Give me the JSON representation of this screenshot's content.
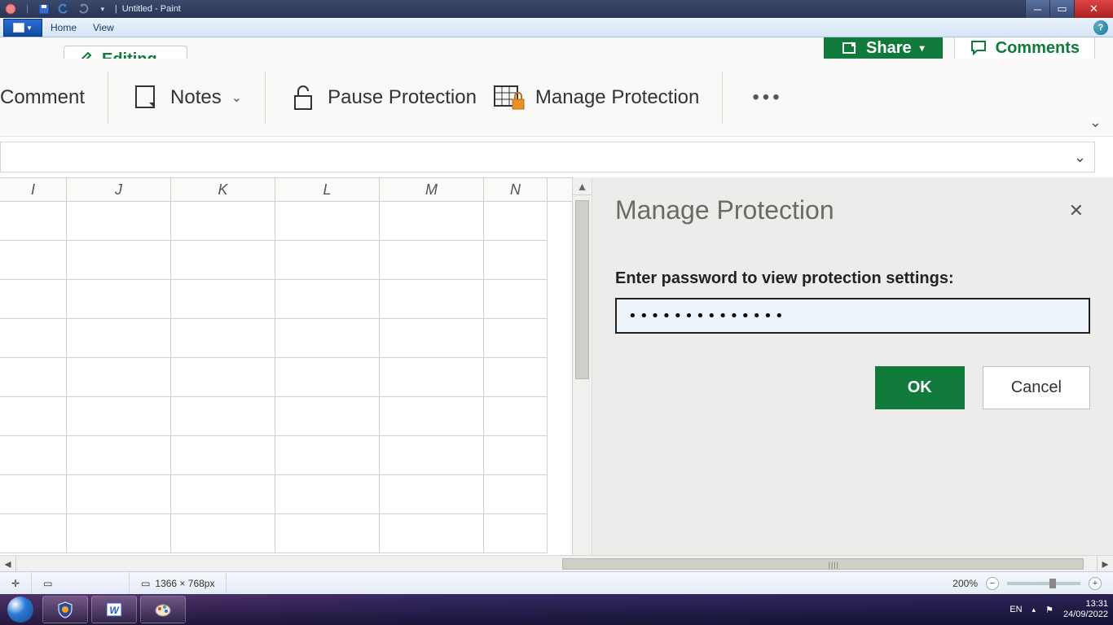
{
  "win7": {
    "title": "Untitled - Paint",
    "menus": {
      "home": "Home",
      "view": "View"
    }
  },
  "excel": {
    "topbar": {
      "editing_label": "Editing",
      "share_label": "Share",
      "comments_label": "Comments"
    },
    "ribbon": {
      "comment_label": "Comment",
      "notes_label": "Notes",
      "pause_protection_label": "Pause Protection",
      "manage_protection_label": "Manage Protection"
    },
    "columns": [
      "I",
      "J",
      "K",
      "L",
      "M",
      "N"
    ],
    "panel": {
      "title": "Manage Protection",
      "prompt": "Enter password to view protection settings:",
      "password_value": "••••••••••••••",
      "ok_label": "OK",
      "cancel_label": "Cancel"
    }
  },
  "paint_status": {
    "canvas_size": "1366 × 768px",
    "zoom": "200%"
  },
  "tray": {
    "lang": "EN",
    "time": "13:31",
    "date": "24/09/2022"
  }
}
